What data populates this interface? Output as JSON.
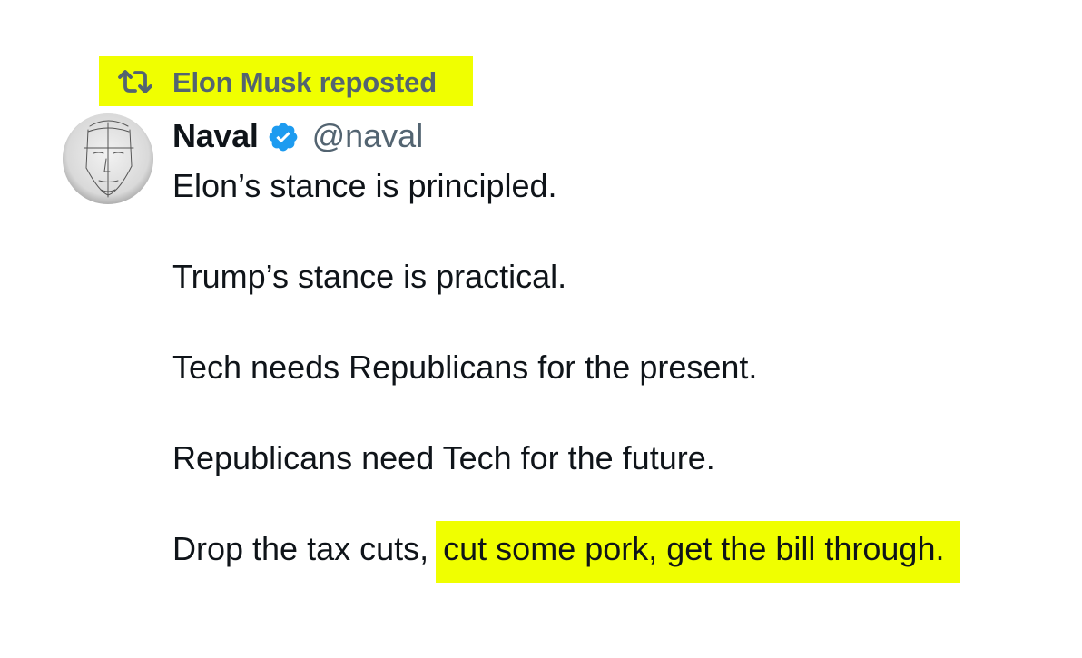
{
  "repost": {
    "icon": "repost-icon",
    "text": "Elon Musk reposted",
    "highlight_color": "#f0ff00",
    "text_color": "#536471"
  },
  "author": {
    "avatar_icon": "avatar-sketch",
    "display_name": "Naval",
    "verified_icon": "verified-badge-icon",
    "verified_color": "#1d9bf0",
    "handle": "@naval"
  },
  "tweet": {
    "paragraphs": [
      {
        "text": "Elon’s stance is principled."
      },
      {
        "text": "Trump’s stance is practical."
      },
      {
        "text": "Tech needs Republicans for the present."
      },
      {
        "text": "Republicans need Tech for the future."
      },
      {
        "text": "Drop the tax cuts,",
        "highlighted": "cut some pork, get the bill through."
      }
    ]
  }
}
